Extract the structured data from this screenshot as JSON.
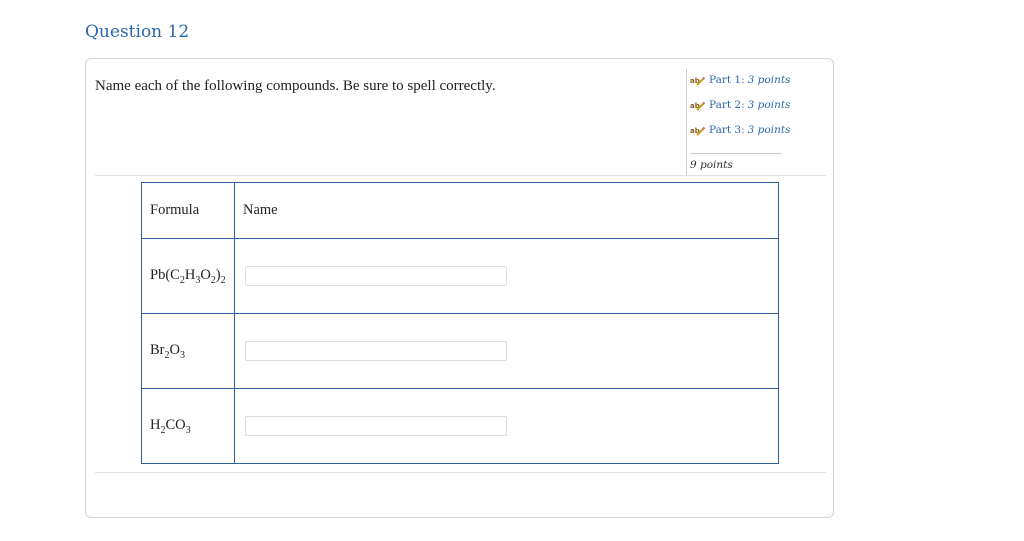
{
  "question": {
    "title": "Question 12",
    "prompt": "Name each of the following compounds. Be sure to spell correctly."
  },
  "parts": [
    {
      "label": "Part 1:",
      "points": "3 points",
      "icon": "ab-pencil-icon"
    },
    {
      "label": "Part 2:",
      "points": "3 points",
      "icon": "ab-pencil-icon"
    },
    {
      "label": "Part 3:",
      "points": "3 points",
      "icon": "ab-pencil-icon"
    }
  ],
  "total_points": "9 points",
  "table": {
    "headers": [
      "Formula",
      "Name"
    ],
    "rows": [
      {
        "formula": "Pb(C2H3O2)2",
        "answer_value": "",
        "answer_placeholder": ""
      },
      {
        "formula": "Br2O3",
        "answer_value": "",
        "answer_placeholder": ""
      },
      {
        "formula": "H2CO3",
        "answer_value": "",
        "answer_placeholder": ""
      }
    ]
  },
  "colors": {
    "accent": "#2c68a8",
    "table_border": "#2e5f9b"
  }
}
